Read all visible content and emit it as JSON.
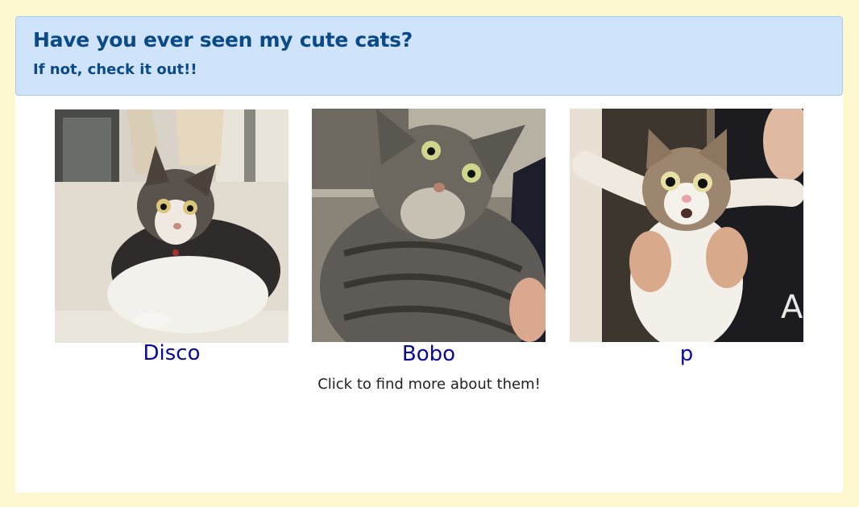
{
  "header": {
    "title": "Have you ever seen my cute cats?",
    "subtitle": "If not, check it out!!"
  },
  "cats": [
    {
      "name": "Disco",
      "image_desc": "tabby-and-white cat lying on floor",
      "image_name": "cat-photo"
    },
    {
      "name": "Bobo",
      "image_desc": "grey tabby cat held close-up",
      "image_name": "cat-photo"
    },
    {
      "name": "p",
      "image_desc": "tabby-and-white cat held up with paws outstretched",
      "image_name": "cat-photo"
    }
  ],
  "hint": "Click to find more about them!",
  "colors": {
    "page_background": "#fdf8cf",
    "header_background": "#cfe3fb",
    "header_text": "#0b4a86",
    "cat_name": "#0a0a9a"
  }
}
